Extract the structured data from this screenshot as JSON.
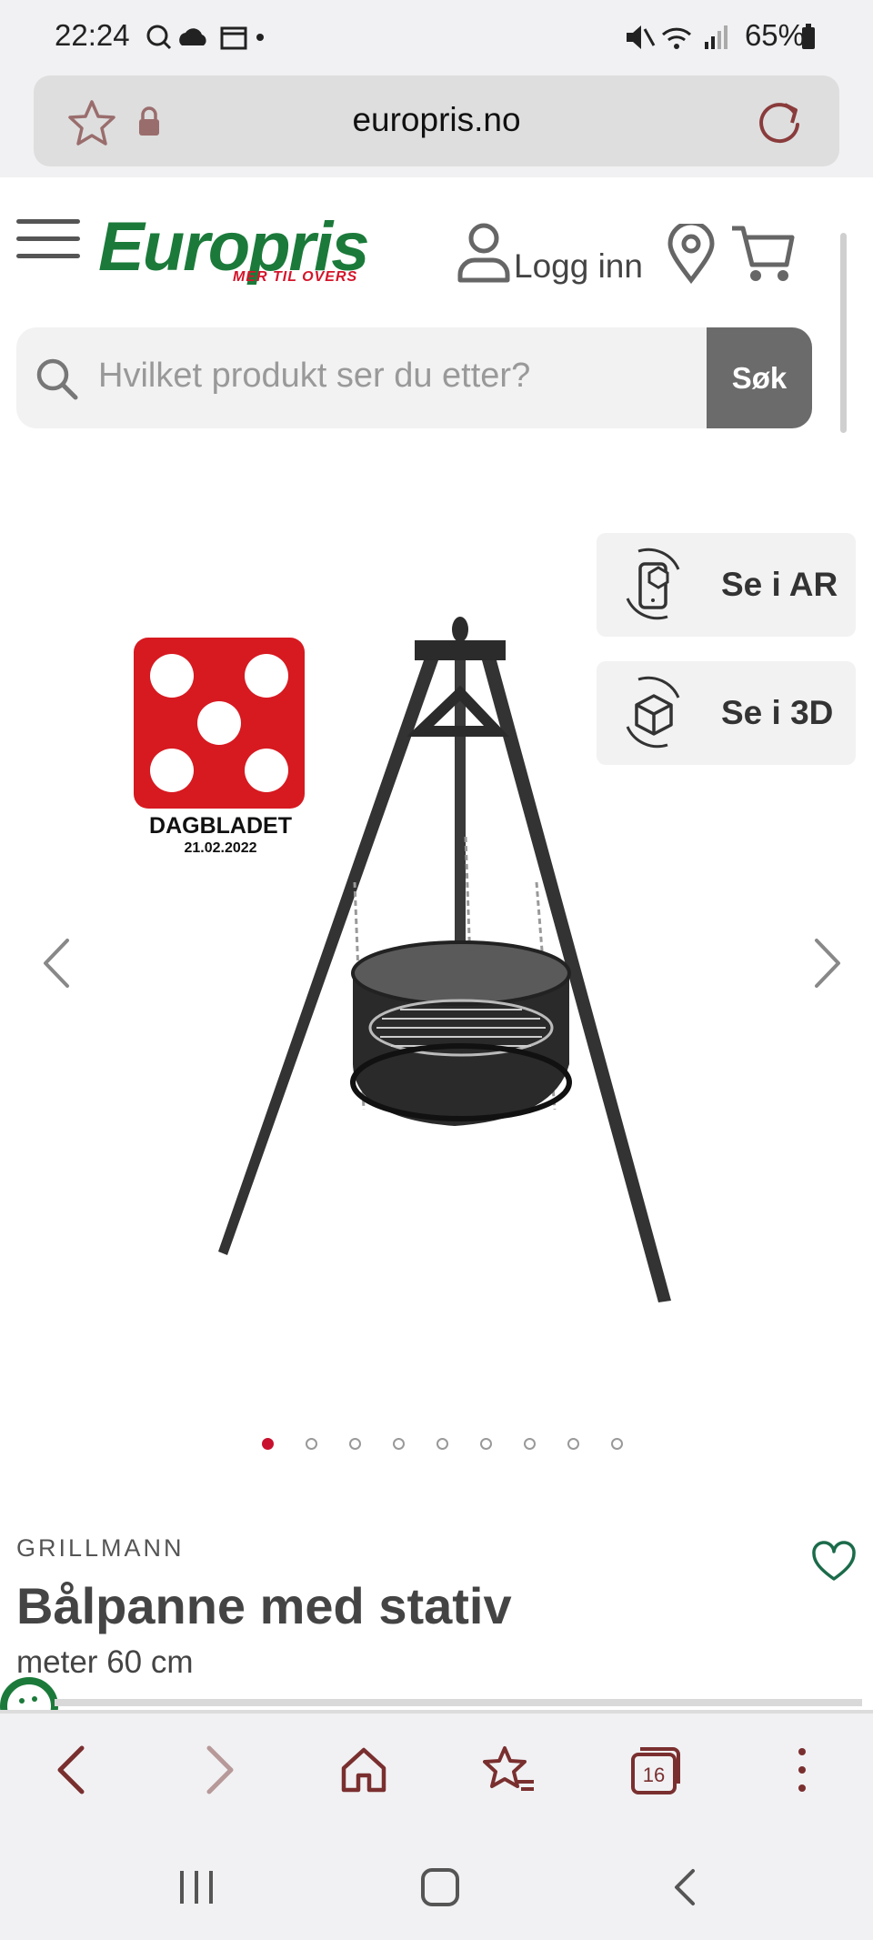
{
  "status_bar": {
    "time": "22:24",
    "battery": "65%"
  },
  "browser": {
    "url": "europris.no",
    "tab_count": "16"
  },
  "site_header": {
    "logo": "Europris",
    "logo_tagline": "MER TIL OVERS",
    "login_label": "Logg inn"
  },
  "search": {
    "placeholder": "Hvilket produkt ser du etter?",
    "button_label": "Søk"
  },
  "view_buttons": {
    "ar_label": "Se i AR",
    "three_d_label": "Se i 3D"
  },
  "badge": {
    "name": "DAGBLADET",
    "date": "21.02.2022",
    "score": 5
  },
  "carousel": {
    "prev_glyph": "‹",
    "next_glyph": "›",
    "image_count": 9,
    "active_index": 0
  },
  "product": {
    "brand": "GRILLMANN",
    "title": "Bålpanne med stativ",
    "subtitle": "meter 60 cm"
  },
  "colors": {
    "brand_green": "#1b7a3a",
    "brand_red": "#d4152a",
    "toolbar_icon": "#7a2f2f"
  }
}
